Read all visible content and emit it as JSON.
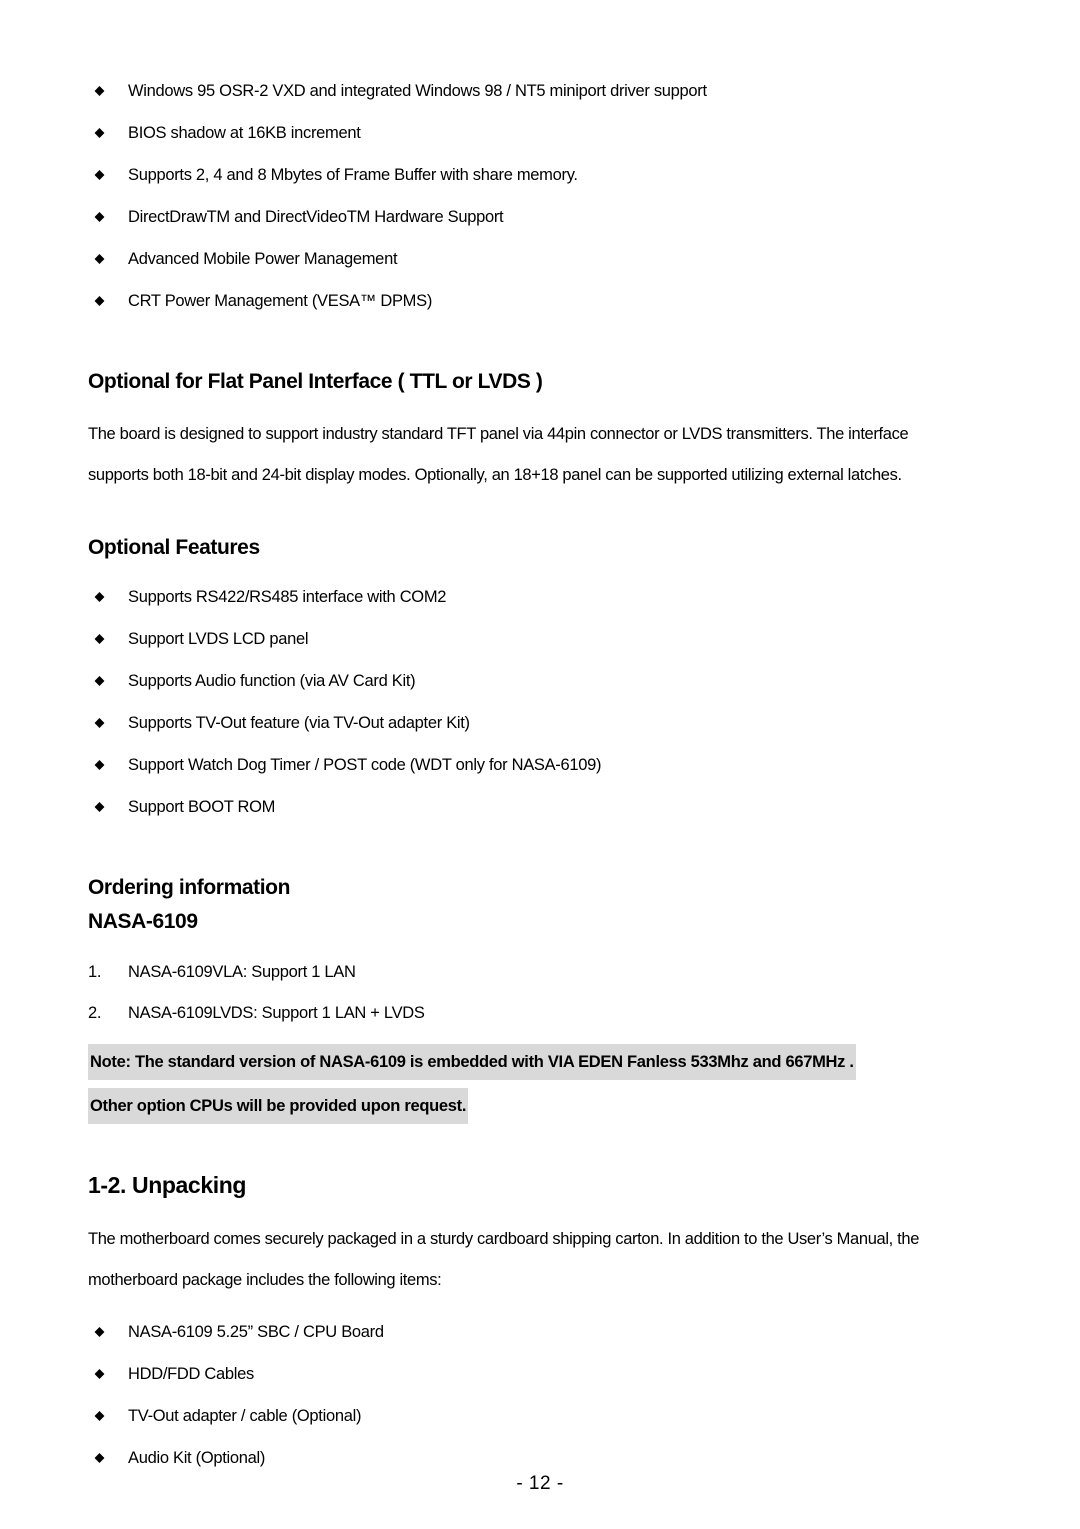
{
  "top_bullets": [
    "Windows 95 OSR-2 VXD and integrated Windows 98 / NT5 miniport    driver support",
    "BIOS shadow at 16KB increment",
    "Supports 2, 4 and 8 Mbytes of Frame Buffer with share memory.",
    "DirectDrawTM and DirectVideoTM Hardware Support",
    "Advanced Mobile Power Management",
    "CRT Power Management (VESA™ DPMS)"
  ],
  "flat_panel": {
    "heading": "Optional for Flat Panel Interface ( TTL or LVDS )",
    "paragraph_line1": "The board is designed to support industry standard TFT panel via 44pin connector or LVDS transmitters. The interface",
    "paragraph_line2": "supports both 18-bit and 24-bit display modes. Optionally, an 18+18 panel can be supported utilizing external latches."
  },
  "optional_features": {
    "heading": "Optional Features",
    "bullets": [
      "Supports RS422/RS485 interface with COM2",
      "Support LVDS LCD panel",
      "Supports Audio function (via AV Card Kit)",
      "Supports TV-Out feature (via TV-Out adapter Kit)",
      "Support Watch Dog Timer / POST code (WDT only for NASA-6109)",
      "Support BOOT ROM"
    ]
  },
  "ordering": {
    "heading": "Ordering information",
    "subheading": "NASA-6109",
    "items": [
      {
        "num": "1.",
        "text": "NASA-6109VLA: Support 1 LAN"
      },
      {
        "num": "2.",
        "text": "NASA-6109LVDS: Support 1 LAN + LVDS"
      }
    ],
    "note_line1": "Note:    The standard version of NASA-6109 is embedded with VIA    EDEN Fanless 533Mhz and 667MHz .",
    "note_line2": "Other option CPUs will be provided upon request."
  },
  "unpacking": {
    "heading": "1-2. Unpacking",
    "paragraph_line1": "The motherboard comes securely packaged in a sturdy cardboard shipping carton. In addition to the User’s Manual, the",
    "paragraph_line2": "motherboard package includes the following items:",
    "bullets": [
      "NASA-6109 5.25” SBC / CPU Board",
      "HDD/FDD Cables",
      "TV-Out adapter / cable (Optional)",
      "Audio Kit (Optional)"
    ]
  },
  "footer": "- 12 -"
}
